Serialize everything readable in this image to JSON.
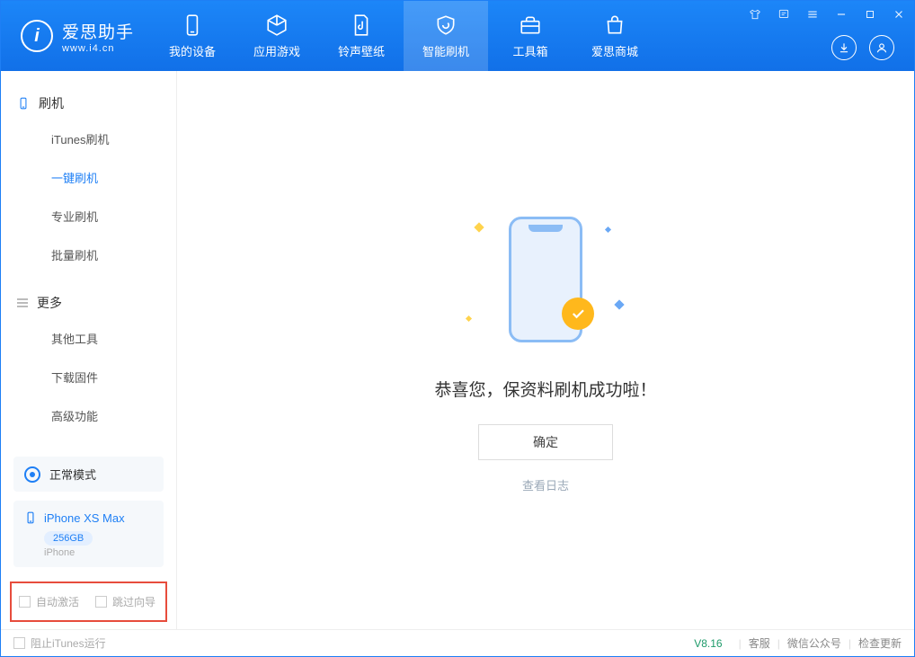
{
  "logo": {
    "cn": "爱思助手",
    "en": "www.i4.cn",
    "glyph": "i"
  },
  "nav": {
    "device": "我的设备",
    "apps": "应用游戏",
    "ringtone": "铃声壁纸",
    "flash": "智能刷机",
    "toolbox": "工具箱",
    "store": "爱思商城"
  },
  "sidebar": {
    "section_flash": "刷机",
    "items_flash": {
      "itunes": "iTunes刷机",
      "oneclick": "一键刷机",
      "pro": "专业刷机",
      "batch": "批量刷机"
    },
    "section_more": "更多",
    "items_more": {
      "other": "其他工具",
      "firmware": "下载固件",
      "advanced": "高级功能"
    },
    "status_mode": "正常模式",
    "device": {
      "name": "iPhone XS Max",
      "storage": "256GB",
      "type": "iPhone"
    },
    "auto_activate": "自动激活",
    "skip_guide": "跳过向导"
  },
  "main": {
    "success_msg": "恭喜您，保资料刷机成功啦！",
    "confirm": "确定",
    "view_log": "查看日志"
  },
  "footer": {
    "block_itunes": "阻止iTunes运行",
    "version": "V8.16",
    "support": "客服",
    "wechat": "微信公众号",
    "update": "检查更新"
  }
}
